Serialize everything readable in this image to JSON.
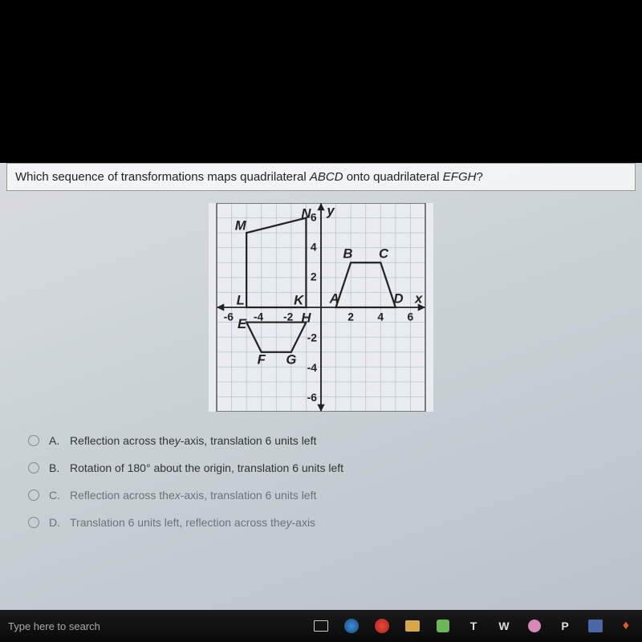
{
  "question": {
    "prefix": "Which sequence of transformations maps quadrilateral ",
    "shape1": "ABCD",
    "middle": " onto quadrilateral ",
    "shape2": "EFGH",
    "suffix": "?"
  },
  "chart_data": {
    "type": "scatter",
    "title": "",
    "xlabel": "x",
    "ylabel": "y",
    "xlim": [
      -7,
      7
    ],
    "ylim": [
      -7,
      7
    ],
    "x_ticks": [
      -6,
      -4,
      -2,
      2,
      4,
      6
    ],
    "y_ticks": [
      -6,
      -4,
      -2,
      2,
      4,
      6
    ],
    "shapes": [
      {
        "name": "ABCD",
        "points": {
          "A": [
            1,
            0
          ],
          "B": [
            2,
            3
          ],
          "C": [
            4,
            3
          ],
          "D": [
            5,
            0
          ]
        }
      },
      {
        "name": "EFGH",
        "points": {
          "E": [
            -5,
            -1
          ],
          "F": [
            -4,
            -3
          ],
          "G": [
            -2,
            -3
          ],
          "H": [
            -1,
            -1
          ]
        }
      },
      {
        "name": "KLMN",
        "points": {
          "K": [
            -1,
            0
          ],
          "L": [
            -5,
            0
          ],
          "M": [
            -5,
            5
          ],
          "N": [
            -1,
            6
          ]
        }
      }
    ]
  },
  "options": [
    {
      "letter": "A.",
      "text_pre": "Reflection across the ",
      "axis": "y",
      "text_post": "-axis, translation 6 units left"
    },
    {
      "letter": "B.",
      "text_pre": "Rotation of 180° about the origin, translation 6 units left",
      "axis": "",
      "text_post": ""
    },
    {
      "letter": "C.",
      "text_pre": "Reflection across the ",
      "axis": "x",
      "text_post": "-axis, translation 6 units left"
    },
    {
      "letter": "D.",
      "text_pre": "Translation 6 units left, reflection across the ",
      "axis": "y",
      "text_post": "-axis"
    }
  ],
  "taskbar": {
    "search_placeholder": "Type here to search",
    "icons": {
      "cortana": "⊟",
      "t": "T",
      "w": "W",
      "p": "P"
    }
  }
}
